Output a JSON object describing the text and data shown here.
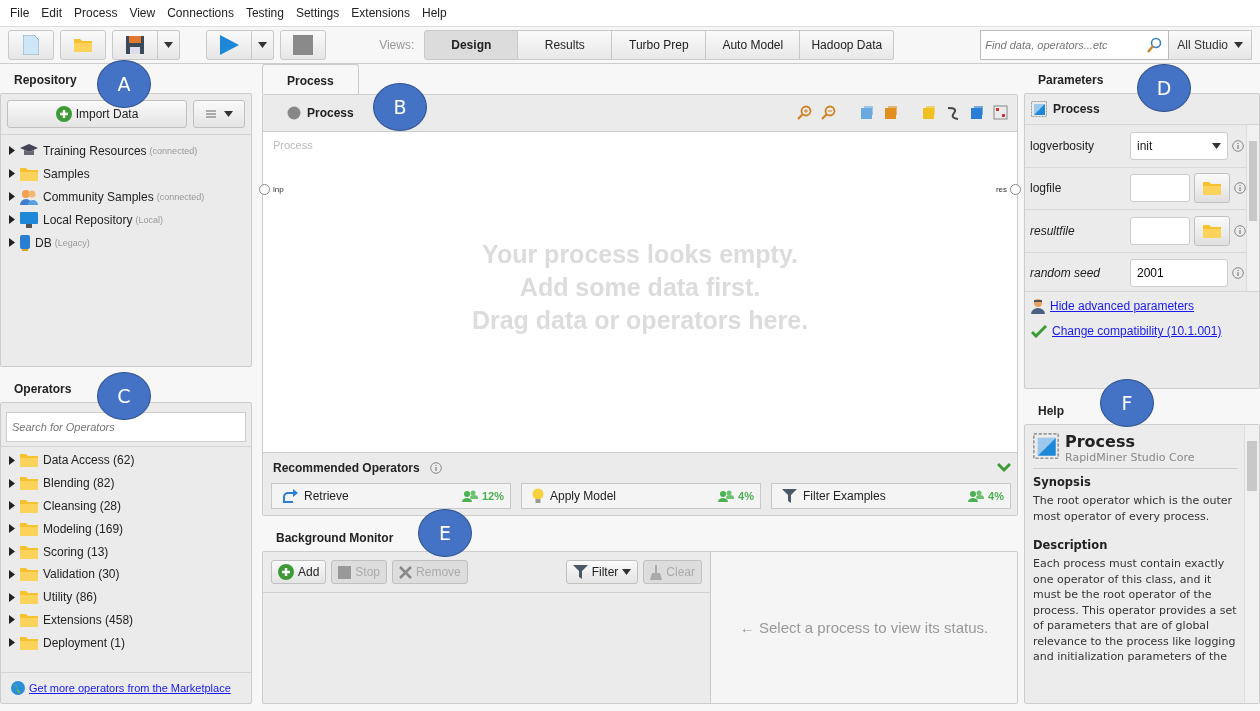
{
  "menu": [
    "File",
    "Edit",
    "Process",
    "View",
    "Connections",
    "Testing",
    "Settings",
    "Extensions",
    "Help"
  ],
  "toolbar": {
    "views_label": "Views:",
    "views": [
      {
        "label": "Design",
        "selected": true
      },
      {
        "label": "Results",
        "selected": false
      },
      {
        "label": "Turbo Prep",
        "selected": false
      },
      {
        "label": "Auto Model",
        "selected": false
      },
      {
        "label": "Hadoop Data",
        "selected": false
      }
    ],
    "search": {
      "placeholder": "Find data, operators...etc"
    },
    "scope": "All Studio"
  },
  "repository": {
    "title": "Repository",
    "import_button": "Import Data",
    "items": [
      {
        "kind": "training",
        "name": "Training Resources",
        "note": "(connected)"
      },
      {
        "kind": "folder",
        "name": "Samples"
      },
      {
        "kind": "community",
        "name": "Community Samples",
        "note": "(connected)"
      },
      {
        "kind": "local",
        "name": "Local Repository",
        "note": "(Local)"
      },
      {
        "kind": "db",
        "name": "DB",
        "note": "(Legacy)"
      }
    ]
  },
  "operators": {
    "title": "Operators",
    "search": {
      "placeholder": "Search for Operators"
    },
    "categories": [
      "Data Access (62)",
      "Blending (82)",
      "Cleansing (28)",
      "Modeling (169)",
      "Scoring (13)",
      "Validation (30)",
      "Utility (86)",
      "Extensions (458)",
      "Deployment (1)"
    ],
    "marketplace_link": "Get more operators from the Marketplace"
  },
  "process": {
    "tab": "Process",
    "breadcrumb": "Process",
    "canvas_label": "Process",
    "input_port": "inp",
    "output_port": "res",
    "empty_message": [
      "Your process looks empty.",
      "Add some data first.",
      "Drag data or operators here."
    ]
  },
  "recommended": {
    "title": "Recommended Operators",
    "items": [
      {
        "kind": "retrieve",
        "name": "Retrieve",
        "share": "12%"
      },
      {
        "kind": "bulb",
        "name": "Apply Model",
        "share": "4%"
      },
      {
        "kind": "filter",
        "name": "Filter Examples",
        "share": "4%"
      }
    ]
  },
  "background_monitor": {
    "title": "Background Monitor",
    "buttons": [
      {
        "kind": "add",
        "label": "Add",
        "disabled": false
      },
      {
        "kind": "stop",
        "label": "Stop",
        "disabled": true
      },
      {
        "kind": "remove",
        "label": "Remove",
        "disabled": true
      },
      {
        "kind": "filter",
        "label": "Filter",
        "disabled": false
      },
      {
        "kind": "clear",
        "label": "Clear",
        "disabled": true
      }
    ],
    "status": "← Select a process to view its status."
  },
  "parameters": {
    "title": "Parameters",
    "operator": "Process",
    "rows": [
      {
        "name": "logverbosity",
        "advanced": false,
        "kind": "select",
        "value": "init"
      },
      {
        "name": "logfile",
        "advanced": false,
        "kind": "file"
      },
      {
        "name": "resultfile",
        "advanced": true,
        "kind": "file"
      },
      {
        "name": "random seed",
        "advanced": true,
        "kind": "text",
        "value": "2001"
      }
    ],
    "links": [
      {
        "kind": "person",
        "label": "Hide advanced parameters"
      },
      {
        "kind": "check",
        "label": "Change compatibility (10.1.001)"
      }
    ]
  },
  "help": {
    "title": "Help",
    "operator": "Process",
    "source": "RapidMiner Studio Core",
    "sections": [
      {
        "heading": "Synopsis",
        "text": "The root operator which is the outer most operator of every process."
      },
      {
        "heading": "Description",
        "text": "Each process must contain exactly one operator of this class, and it must be the root operator of the process. This operator provides a set of parameters that are of global relevance to the process like logging and initialization parameters of the"
      }
    ]
  },
  "callouts": [
    "A",
    "B",
    "C",
    "D",
    "E",
    "F"
  ]
}
